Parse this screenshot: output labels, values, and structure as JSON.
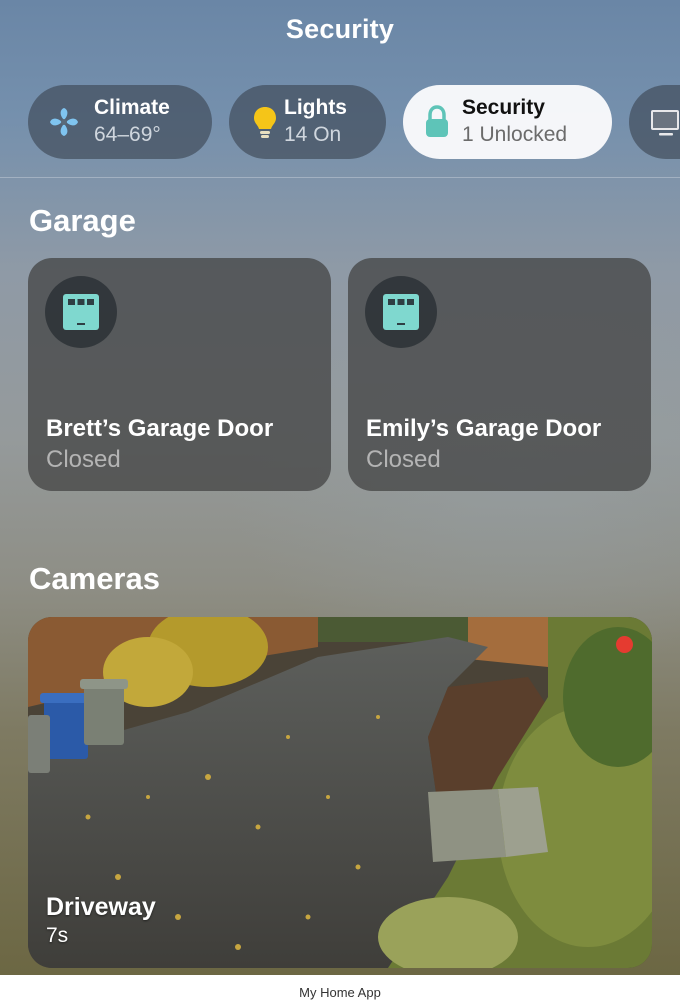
{
  "header": {
    "title": "Security"
  },
  "categories": [
    {
      "title": "Climate",
      "subtitle": "64–69°",
      "icon": "fan-icon"
    },
    {
      "title": "Lights",
      "subtitle": "14 On",
      "icon": "lightbulb-icon"
    },
    {
      "title": "Security",
      "subtitle": "1 Unlocked",
      "icon": "lock-icon",
      "active": true
    },
    {
      "title": "",
      "subtitle": "",
      "icon": "tv-icon"
    }
  ],
  "garage": {
    "heading": "Garage",
    "doors": [
      {
        "name": "Brett’s Garage Door",
        "status": "Closed",
        "icon": "garage-door-icon"
      },
      {
        "name": "Emily’s Garage Door",
        "status": "Closed",
        "icon": "garage-door-icon"
      }
    ]
  },
  "cameras": {
    "heading": "Cameras",
    "items": [
      {
        "name": "Driveway",
        "age": "7s",
        "recording_color": "#e53b30"
      }
    ]
  },
  "caption": "My Home App",
  "colors": {
    "accent_teal": "#7fd8cf",
    "lightbulb_yellow": "#f5c518",
    "fan_blue": "#7fc4f0",
    "recording_red": "#e53b30"
  }
}
